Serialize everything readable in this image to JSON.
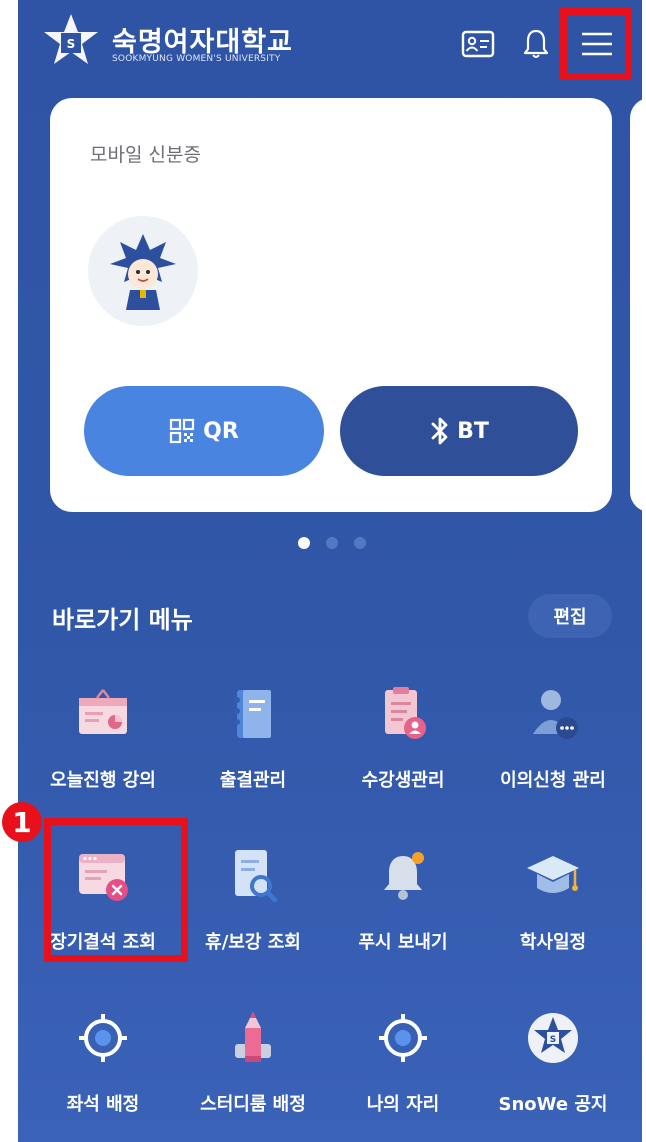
{
  "header": {
    "university_name": "숙명여자대학교",
    "university_name_en": "SOOKMYUNG WOMEN'S UNIVERSITY",
    "icons": [
      "id-card-icon",
      "bell-icon",
      "hamburger-menu-icon"
    ]
  },
  "card": {
    "title": "모바일 신분증",
    "qr_label": "QR",
    "bt_label": "BT"
  },
  "carousel": {
    "pages": 3,
    "active": 1
  },
  "shortcut": {
    "title": "바로가기 메뉴",
    "edit_label": "편집",
    "items": [
      {
        "label": "오늘진행 강의",
        "icon": "lecture-board-icon"
      },
      {
        "label": "출결관리",
        "icon": "notebook-icon"
      },
      {
        "label": "수강생관리",
        "icon": "student-clipboard-icon"
      },
      {
        "label": "이의신청 관리",
        "icon": "person-more-icon"
      },
      {
        "label": "장기결석 조회",
        "icon": "window-cancel-icon"
      },
      {
        "label": "휴/보강 조회",
        "icon": "document-search-icon"
      },
      {
        "label": "푸시 보내기",
        "icon": "bell-notify-icon"
      },
      {
        "label": "학사일정",
        "icon": "graduation-cap-icon"
      },
      {
        "label": "좌석 배정",
        "icon": "target-icon"
      },
      {
        "label": "스터디룸 배정",
        "icon": "pencil-icon"
      },
      {
        "label": "나의 자리",
        "icon": "target-icon"
      },
      {
        "label": "SnoWe 공지",
        "icon": "snowe-emblem-icon"
      }
    ]
  },
  "annotation": {
    "step_number": "1"
  }
}
